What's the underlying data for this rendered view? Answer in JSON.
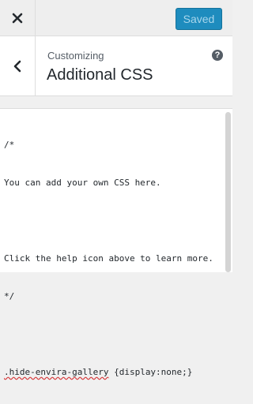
{
  "topbar": {
    "close_icon": "close-icon",
    "save_label": "Saved"
  },
  "section": {
    "back_icon": "chevron-left-icon",
    "breadcrumb": "Customizing",
    "title": "Additional CSS",
    "help_icon": "help-icon",
    "help_glyph": "?"
  },
  "editor": {
    "lines": [
      "/*",
      "You can add your own CSS here.",
      "",
      "Click the help icon above to learn more.",
      "*/",
      "",
      "{display:none;}"
    ],
    "css_selector": ".hide-envira-gallery"
  },
  "colors": {
    "save_button": "#1e8cbe",
    "save_text": "#a8d6ec",
    "panel_bg": "#f0f0f0"
  }
}
